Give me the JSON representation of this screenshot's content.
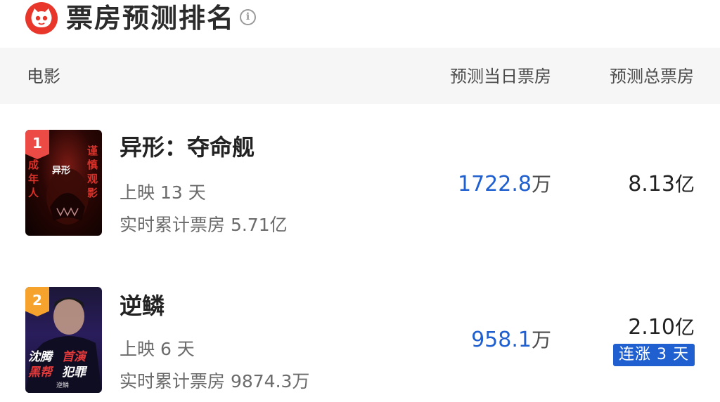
{
  "header": {
    "title": "票房预测排名",
    "info_icon": "info-icon",
    "brand_color": "#e8362b"
  },
  "table_header": {
    "movie": "电影",
    "day_forecast": "预测当日票房",
    "total_forecast": "预测总票房"
  },
  "rows": [
    {
      "rank": "1",
      "name": "异形：夺命舰",
      "days_label": "上映 13 天",
      "cum_label": "实时累计票房 5.71亿",
      "day_value": "1722.8",
      "day_unit": "万",
      "total_value": "8.13",
      "total_unit": "亿",
      "rank_color": "#ec4a45"
    },
    {
      "rank": "2",
      "name": "逆鳞",
      "days_label": "上映 6 天",
      "cum_label": "实时累计票房 9874.3万",
      "day_value": "958.1",
      "day_unit": "万",
      "total_value": "2.10",
      "total_unit": "亿",
      "badge": "连涨 3 天",
      "rank_color": "#f5a32c"
    }
  ],
  "colors": {
    "accent_blue": "#1f5fd0",
    "header_bg": "#f6f6f6"
  }
}
